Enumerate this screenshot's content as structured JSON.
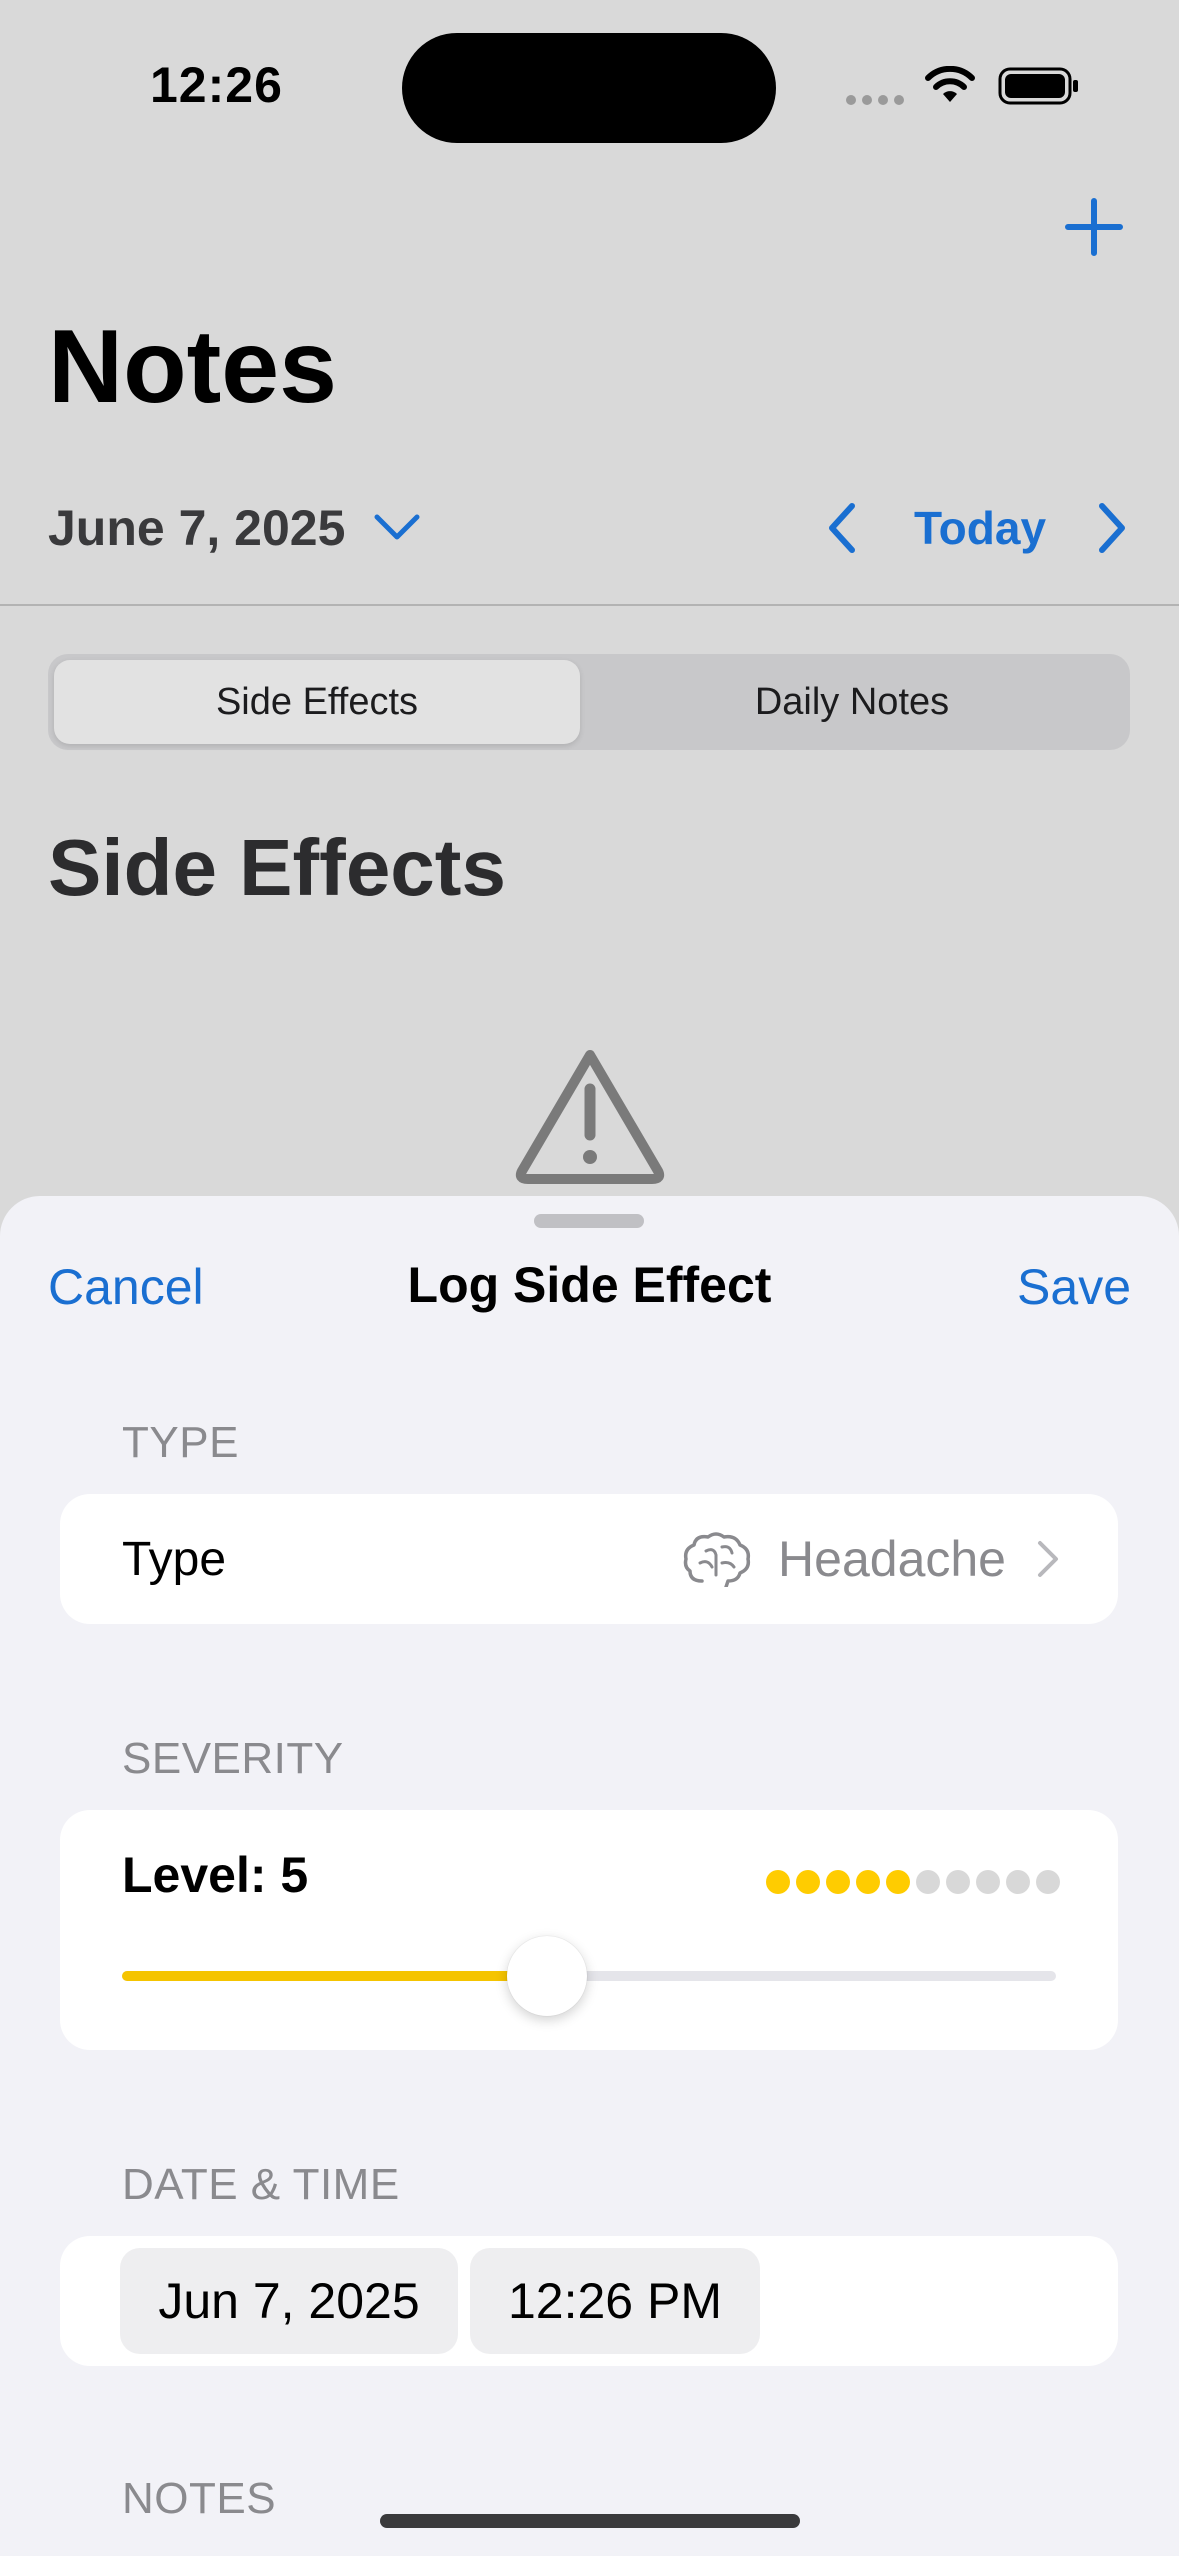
{
  "status_bar": {
    "time": "12:26"
  },
  "header": {
    "title": "Notes"
  },
  "date_nav": {
    "date": "June 7, 2025",
    "today_label": "Today"
  },
  "segments": {
    "items": [
      "Side Effects",
      "Daily Notes"
    ],
    "selected": "Side Effects"
  },
  "section": {
    "title": "Side Effects"
  },
  "sheet": {
    "cancel_label": "Cancel",
    "title": "Log Side Effect",
    "save_label": "Save",
    "type_group_label": "TYPE",
    "type_row_label": "Type",
    "type_value": "Headache",
    "type_icon": "brain-icon",
    "severity_group_label": "SEVERITY",
    "severity_text": "Level: 5",
    "severity_level": 5,
    "severity_max": 10,
    "datetime_group_label": "DATE & TIME",
    "date_value": "Jun 7, 2025",
    "time_value": "12:26 PM",
    "notes_group_label": "NOTES"
  },
  "colors": {
    "accent": "#1a6fd1",
    "severity": "#ffcc00"
  }
}
